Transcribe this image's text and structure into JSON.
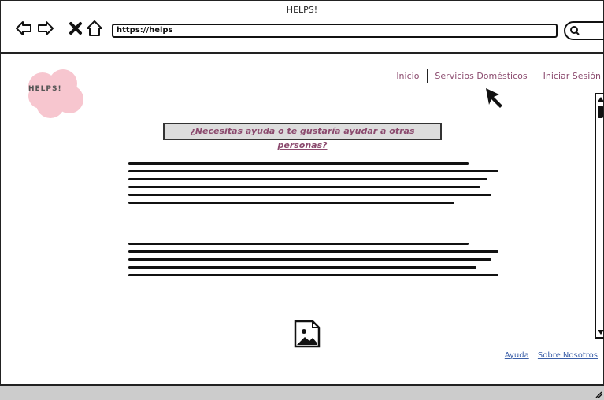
{
  "window": {
    "title": "HELPS!"
  },
  "browser": {
    "url": "https://helps"
  },
  "logo": {
    "text": "HELPS!"
  },
  "nav": {
    "items": [
      {
        "label": "Inicio"
      },
      {
        "label": "Servicios Domésticos"
      },
      {
        "label": "Iniciar Sesión"
      }
    ]
  },
  "main": {
    "question": "¿Necesitas ayuda o te gustaría ayudar a otras personas?"
  },
  "footer": {
    "help": "Ayuda",
    "about": "Sobre Nosotros"
  },
  "colors": {
    "link": "#8b4a6e",
    "footer_link": "#3b5fa8",
    "logo": "#f7c6cf"
  }
}
